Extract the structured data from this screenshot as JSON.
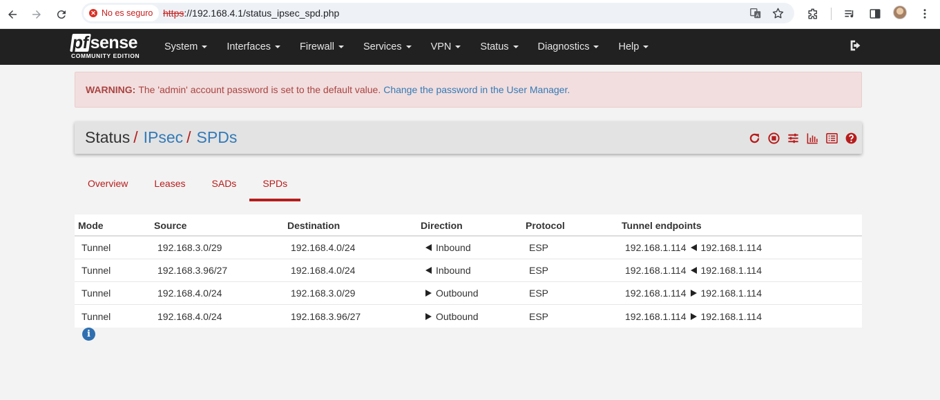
{
  "browser": {
    "security_label": "No es seguro",
    "url_scheme": "https",
    "url_rest": "://192.168.4.1/status_ipsec_spd.php"
  },
  "brand": {
    "name_part1": "pf",
    "name_part2": "sense",
    "edition": "COMMUNITY EDITION"
  },
  "menu": [
    "System",
    "Interfaces",
    "Firewall",
    "Services",
    "VPN",
    "Status",
    "Diagnostics",
    "Help"
  ],
  "warning": {
    "label": "WARNING:",
    "text": "The 'admin' account password is set to the default value.",
    "link": "Change the password in the User Manager."
  },
  "breadcrumb": {
    "root": "Status",
    "level1": "IPsec",
    "level2": "SPDs",
    "separator": "/"
  },
  "tabs": [
    {
      "label": "Overview",
      "active": false
    },
    {
      "label": "Leases",
      "active": false
    },
    {
      "label": "SADs",
      "active": false
    },
    {
      "label": "SPDs",
      "active": true
    }
  ],
  "table": {
    "headers": [
      "Mode",
      "Source",
      "Destination",
      "Direction",
      "Protocol",
      "Tunnel endpoints"
    ],
    "rows": [
      {
        "mode": "Tunnel",
        "source": "192.168.3.0/29",
        "destination": "192.168.4.0/24",
        "direction": "Inbound",
        "arrow": "left",
        "protocol": "ESP",
        "ep_local": "192.168.1.114",
        "ep_remote": "192.168.1.114"
      },
      {
        "mode": "Tunnel",
        "source": "192.168.3.96/27",
        "destination": "192.168.4.0/24",
        "direction": "Inbound",
        "arrow": "left",
        "protocol": "ESP",
        "ep_local": "192.168.1.114",
        "ep_remote": "192.168.1.114"
      },
      {
        "mode": "Tunnel",
        "source": "192.168.4.0/24",
        "destination": "192.168.3.0/29",
        "direction": "Outbound",
        "arrow": "right",
        "protocol": "ESP",
        "ep_local": "192.168.1.114",
        "ep_remote": "192.168.1.114"
      },
      {
        "mode": "Tunnel",
        "source": "192.168.4.0/24",
        "destination": "192.168.3.96/27",
        "direction": "Outbound",
        "arrow": "right",
        "protocol": "ESP",
        "ep_local": "192.168.1.114",
        "ep_remote": "192.168.1.114"
      }
    ]
  },
  "colors": {
    "accent_red": "#b71c1c",
    "link_blue": "#337ab7",
    "navbar": "#212121",
    "alert_bg": "#f2dede"
  },
  "icons": [
    "back-icon",
    "forward-icon",
    "reload-icon",
    "translate-icon",
    "star-icon",
    "extensions-icon",
    "media-icon",
    "sidepanel-icon",
    "menu-dots-icon",
    "logout-icon",
    "refresh-icon",
    "stop-icon",
    "settings-sliders-icon",
    "graph-icon",
    "log-icon",
    "help-icon",
    "info-icon"
  ]
}
